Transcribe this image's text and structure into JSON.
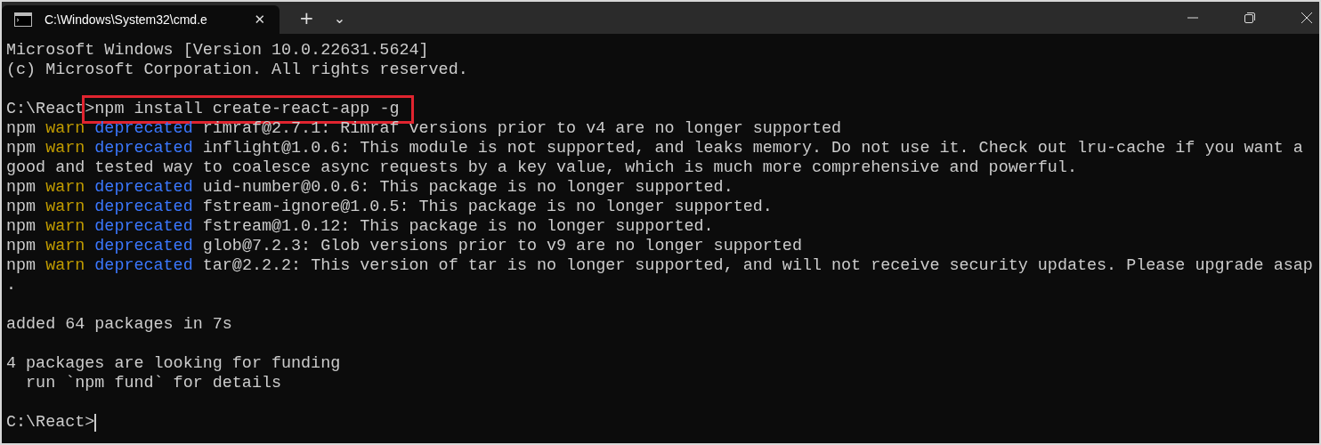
{
  "window": {
    "tab_title": "C:\\Windows\\System32\\cmd.e",
    "tab_close": "✕",
    "new_tab": "+",
    "dropdown": "⌄"
  },
  "lines": [
    {
      "kind": "text",
      "segments": [
        {
          "kind": "plain",
          "text": "Microsoft Windows [Version 10.0.22631.5624]"
        }
      ]
    },
    {
      "kind": "text",
      "segments": [
        {
          "kind": "plain",
          "text": "(c) Microsoft Corporation. All rights reserved."
        }
      ]
    },
    {
      "kind": "blank"
    },
    {
      "kind": "text",
      "segments": [
        {
          "kind": "plain",
          "text": "C:\\React"
        },
        {
          "kind": "command",
          "highlighted": true,
          "text": ">npm install create-react-app -g"
        }
      ]
    },
    {
      "kind": "text",
      "segments": [
        {
          "kind": "plain",
          "text": "npm"
        },
        {
          "kind": "warn",
          "text": "warn"
        },
        {
          "kind": "deprecated",
          "text": "deprecated"
        },
        {
          "kind": "plain",
          "text": "rimraf@2.7.1: Rimraf versions prior to v4 are no longer supported"
        }
      ]
    },
    {
      "kind": "text",
      "segments": [
        {
          "kind": "plain",
          "text": "npm"
        },
        {
          "kind": "warn",
          "text": "warn"
        },
        {
          "kind": "deprecated",
          "text": "deprecated"
        },
        {
          "kind": "plain",
          "text": "inflight@1.0.6: This module is not supported, and leaks memory. Do not use it. Check out lru-cache if you want a"
        }
      ]
    },
    {
      "kind": "text",
      "segments": [
        {
          "kind": "plain",
          "text": "good and tested way to coalesce async requests by a key value, which is much more comprehensive and powerful."
        }
      ]
    },
    {
      "kind": "text",
      "segments": [
        {
          "kind": "plain",
          "text": "npm"
        },
        {
          "kind": "warn",
          "text": "warn"
        },
        {
          "kind": "deprecated",
          "text": "deprecated"
        },
        {
          "kind": "plain",
          "text": "uid-number@0.0.6: This package is no longer supported."
        }
      ]
    },
    {
      "kind": "text",
      "segments": [
        {
          "kind": "plain",
          "text": "npm"
        },
        {
          "kind": "warn",
          "text": "warn"
        },
        {
          "kind": "deprecated",
          "text": "deprecated"
        },
        {
          "kind": "plain",
          "text": "fstream-ignore@1.0.5: This package is no longer supported."
        }
      ]
    },
    {
      "kind": "text",
      "segments": [
        {
          "kind": "plain",
          "text": "npm"
        },
        {
          "kind": "warn",
          "text": "warn"
        },
        {
          "kind": "deprecated",
          "text": "deprecated"
        },
        {
          "kind": "plain",
          "text": "fstream@1.0.12: This package is no longer supported."
        }
      ]
    },
    {
      "kind": "text",
      "segments": [
        {
          "kind": "plain",
          "text": "npm"
        },
        {
          "kind": "warn",
          "text": "warn"
        },
        {
          "kind": "deprecated",
          "text": "deprecated"
        },
        {
          "kind": "plain",
          "text": "glob@7.2.3: Glob versions prior to v9 are no longer supported"
        }
      ]
    },
    {
      "kind": "text",
      "segments": [
        {
          "kind": "plain",
          "text": "npm"
        },
        {
          "kind": "warn",
          "text": "warn"
        },
        {
          "kind": "deprecated",
          "text": "deprecated"
        },
        {
          "kind": "plain",
          "text": "tar@2.2.2: This version of tar is no longer supported, and will not receive security updates. Please upgrade asap"
        }
      ]
    },
    {
      "kind": "text",
      "segments": [
        {
          "kind": "plain",
          "text": "."
        }
      ]
    },
    {
      "kind": "blank"
    },
    {
      "kind": "text",
      "segments": [
        {
          "kind": "plain",
          "text": "added 64 packages in 7s"
        }
      ]
    },
    {
      "kind": "blank"
    },
    {
      "kind": "text",
      "segments": [
        {
          "kind": "plain",
          "text": "4 packages are looking for funding"
        }
      ]
    },
    {
      "kind": "text",
      "segments": [
        {
          "kind": "plain",
          "text": "  run `npm fund` for details"
        }
      ]
    },
    {
      "kind": "blank"
    },
    {
      "kind": "prompt",
      "segments": [
        {
          "kind": "plain",
          "text": "C:\\React>"
        }
      ]
    }
  ]
}
